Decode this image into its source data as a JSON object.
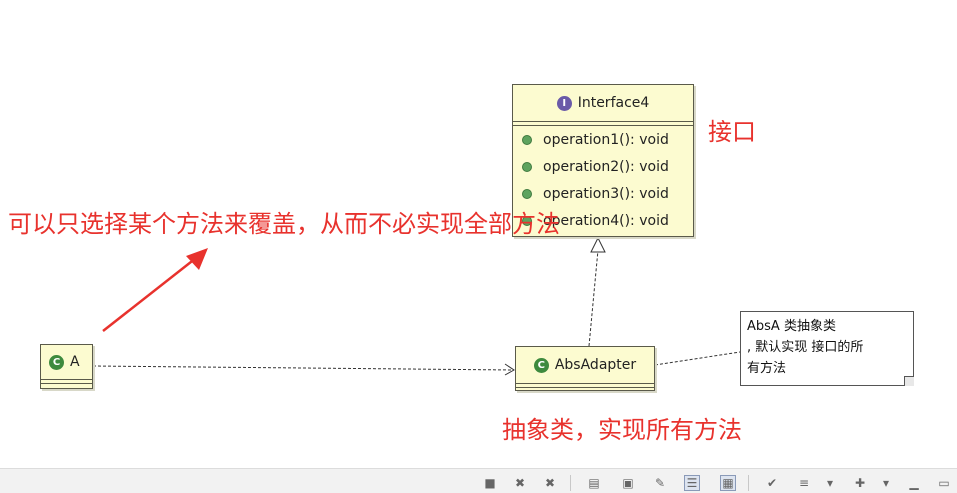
{
  "diagram": {
    "interface": {
      "stereotype_badge": "I",
      "name": "Interface4",
      "operations": [
        "operation1(): void",
        "operation2(): void",
        "operation3(): void",
        "operation4(): void"
      ]
    },
    "class_a": {
      "badge": "C",
      "name": "A"
    },
    "abs_adapter": {
      "badge": "C",
      "name": "AbsAdapter"
    },
    "note": {
      "lines": [
        "AbsA 类抽象类",
        ", 默认实现 接口的所",
        "有方法"
      ]
    }
  },
  "annotations": {
    "interface_label": "接口",
    "override_label": "可以只选择某个方法来覆盖，从而不必实现全部方法",
    "abstract_label": "抽象类，实现所有方法",
    "color": "#e8322d"
  },
  "toolbar": {
    "icons": [
      "square-icon",
      "close-icon",
      "close-all-icon",
      "document-icon",
      "window-icon",
      "edit-icon",
      "list-view-icon",
      "grid-view-icon",
      "checkmark-icon",
      "menu-icon",
      "dropdown-icon",
      "add-icon",
      "dropdown-icon",
      "minimize-icon",
      "maximize-icon"
    ]
  }
}
